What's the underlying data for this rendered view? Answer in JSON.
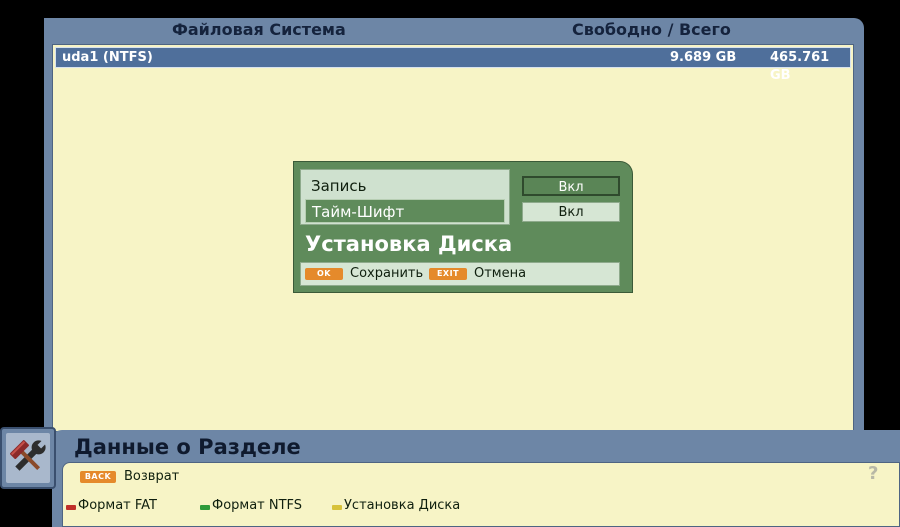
{
  "header": {
    "filesystem_label": "Файловая Система",
    "free_total_label": "Свободно  /  Всего"
  },
  "drives": [
    {
      "name": "uda1 (NTFS)",
      "free": "9.689  GB",
      "total": "465.761  GB",
      "selected": true
    }
  ],
  "dialog": {
    "options": [
      {
        "label": "Запись",
        "value": "Вкл",
        "active": false
      },
      {
        "label": "Тайм-Шифт",
        "value": "Вкл",
        "active": true
      }
    ],
    "title": "Установка Диска",
    "ok_key": "OK",
    "ok_label": "Сохранить",
    "exit_key": "EXIT",
    "exit_label": "Отмена"
  },
  "info": {
    "title": "Данные о Разделе",
    "back_key": "BACK",
    "back_label": "Возврат",
    "help_symbol": "?",
    "actions": [
      {
        "color": "#c0302a",
        "label": "Формат FAT"
      },
      {
        "color": "#2f9a3a",
        "label": "Формат NTFS"
      },
      {
        "color": "#d7c23a",
        "label": "Установка Диска"
      }
    ]
  },
  "tool_icon": "tools-icon",
  "colors": {
    "frame": "#6d86a6",
    "panel": "#f7f4c6",
    "dialog": "#5f8b5b",
    "selected_row": "#4f6f9b",
    "key_orange": "#e58a2b"
  }
}
